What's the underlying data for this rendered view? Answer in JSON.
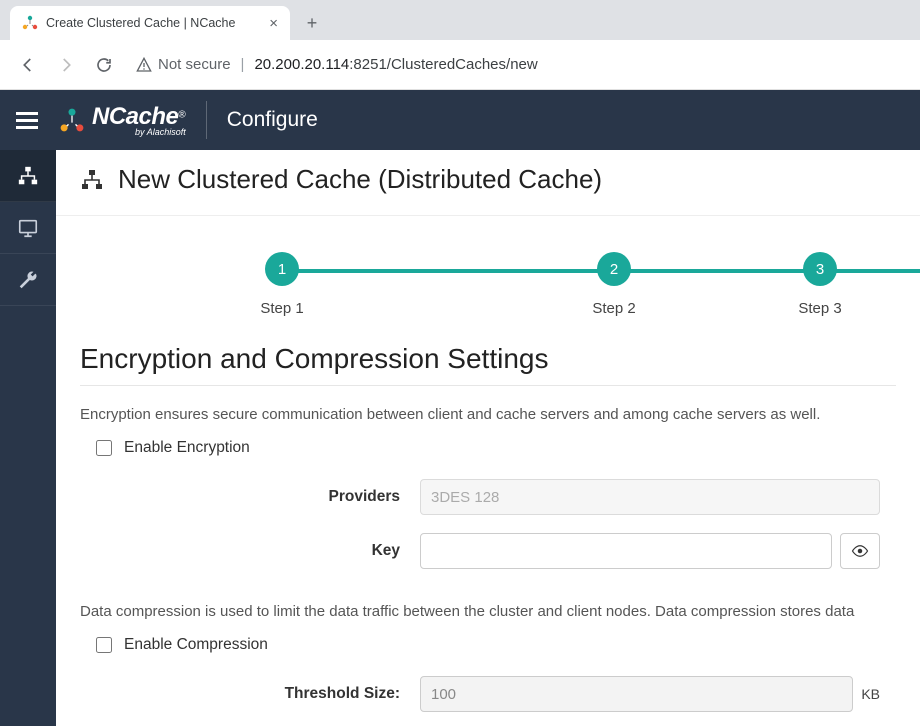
{
  "browser": {
    "tab_title": "Create Clustered Cache | NCache",
    "not_secure": "Not secure",
    "url_host": "20.200.20.114",
    "url_port_path": ":8251/ClusteredCaches/new"
  },
  "header": {
    "logo_main": "NCache",
    "logo_sub": "by Alachisoft",
    "breadcrumb": "Configure"
  },
  "page": {
    "title": "New Clustered Cache (Distributed Cache)"
  },
  "steps": [
    {
      "num": "1",
      "label": "Step 1"
    },
    {
      "num": "2",
      "label": "Step 2"
    },
    {
      "num": "3",
      "label": "Step 3"
    }
  ],
  "section": {
    "title": "Encryption and Compression Settings",
    "encryption_desc": "Encryption ensures secure communication between client and cache servers and among cache servers as well.",
    "enable_encryption_label": "Enable Encryption",
    "providers_label": "Providers",
    "providers_value": "3DES 128",
    "key_label": "Key",
    "key_value": "",
    "compression_desc": "Data compression is used to limit the data traffic between the cluster and client nodes. Data compression stores data",
    "enable_compression_label": "Enable Compression",
    "threshold_label": "Threshold Size:",
    "threshold_value": "100",
    "threshold_unit": "KB"
  }
}
